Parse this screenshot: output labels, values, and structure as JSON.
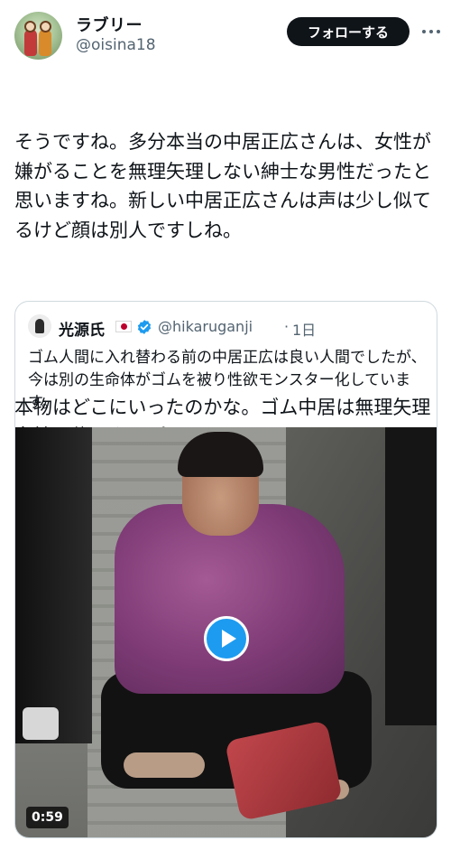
{
  "author": {
    "display_name": "ラブリー",
    "handle": "@oisina18",
    "avatar_icon": "avatar-dolls-icon"
  },
  "actions": {
    "follow_label": "フォローする",
    "more_icon": "more-icon"
  },
  "tweet": {
    "paragraphs": [
      "そうですね。多分本当の中居正広さんは、女性が嫌がることを無理矢理しない紳士な男性だったと思いますね。新しい中居正広さんは声は少し似てるけど顔は別人ですしね。",
      "本物はどこにいったのかな。ゴム中居は無理矢理女性を襲うタイプなのかも。"
    ]
  },
  "quoted": {
    "display_name": "光源氏",
    "flag_icon": "japan-flag-icon",
    "verified_icon": "verified-badge-icon",
    "handle": "@hikaruganji",
    "separator": "·",
    "time": "1日",
    "text": "ゴム人間に入れ替わる前の中居正広は良い人間でしたが、今は別の生命体がゴムを被り性欲モンスター化しています。",
    "media": {
      "type": "video",
      "duration": "0:59",
      "play_icon": "play-icon"
    }
  },
  "colors": {
    "accent": "#1d9bf0",
    "text_primary": "#0f1419",
    "text_secondary": "#536471",
    "border": "#cfd9de"
  }
}
